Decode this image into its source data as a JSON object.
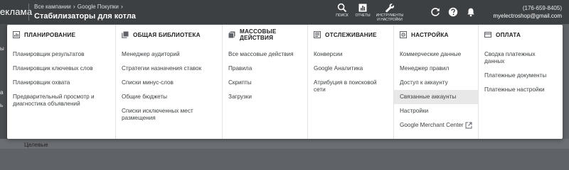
{
  "header": {
    "brand": "еклама",
    "breadcrumb": [
      "Все кампании",
      "Google Покупки"
    ],
    "campaign_title": "Стабилизаторы для котла",
    "tools": [
      {
        "icon": "search-icon",
        "label": "ПОИСК"
      },
      {
        "icon": "reports-icon",
        "label": "ОТЧЕТЫ"
      },
      {
        "icon": "wrench-icon",
        "label": "ИНСТРУМЕНТЫ И НАСТРОЙКИ"
      }
    ],
    "account_id": "(176-659-8405)",
    "account_email": "myelectroshop@gmail.com"
  },
  "behind": {
    "left_labels": [
      "ы",
      "а",
      "ь"
    ],
    "bottom_text": "Целевые"
  },
  "menu": {
    "columns": [
      {
        "icon": "planning-icon",
        "title": "ПЛАНИРОВАНИЕ",
        "items": [
          "Планировщик результатов",
          "Планировщик ключевых слов",
          "Планировщик охвата",
          "Предварительный просмотр и диагностика объявлений"
        ]
      },
      {
        "icon": "library-icon",
        "title": "ОБЩАЯ БИБЛИОТЕКА",
        "items": [
          "Менеджер аудиторий",
          "Стратегии назначения ставок",
          "Списки минус-слов",
          "Общие бюджеты",
          "Списки исключенных мест размещения"
        ]
      },
      {
        "icon": "bulk-actions-icon",
        "title": "МАССОВЫЕ ДЕЙСТВИЯ",
        "items": [
          "Все массовые действия",
          "Правила",
          "Скрипты",
          "Загрузки"
        ]
      },
      {
        "icon": "tracking-icon",
        "title": "ОТСЛЕЖИВАНИЕ",
        "items": [
          "Конверсии",
          "Google Аналитика",
          "Атрибуция в поисковой сети"
        ]
      },
      {
        "icon": "settings-icon",
        "title": "НАСТРОЙКА",
        "items": [
          "Коммерческие данные",
          "Менеджер правил",
          "Доступ к аккаунту",
          "Связанные аккаунты",
          "Настройки",
          "Google Merchant Center"
        ],
        "highlighted_item": "Связанные аккаунты",
        "external_item": "Google Merchant Center"
      },
      {
        "icon": "billing-icon",
        "title": "ОПЛАТА",
        "items": [
          "Сводка платежных данных",
          "Платежные документы",
          "Платежные настройки"
        ]
      }
    ]
  }
}
